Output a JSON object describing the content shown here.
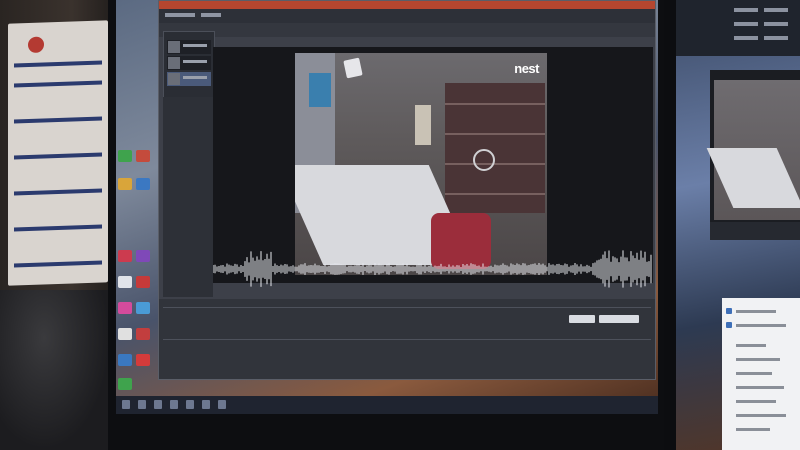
{
  "camera": {
    "brand": "nest"
  },
  "colors": {
    "title_bar": "#b5462f",
    "window_bg": "#3d4049",
    "waveform": "#e6e8ee",
    "stool": "#9b2d3b"
  },
  "icons": [
    "monitor-icon",
    "clip-thumbnail-icon",
    "desktop-icon"
  ]
}
